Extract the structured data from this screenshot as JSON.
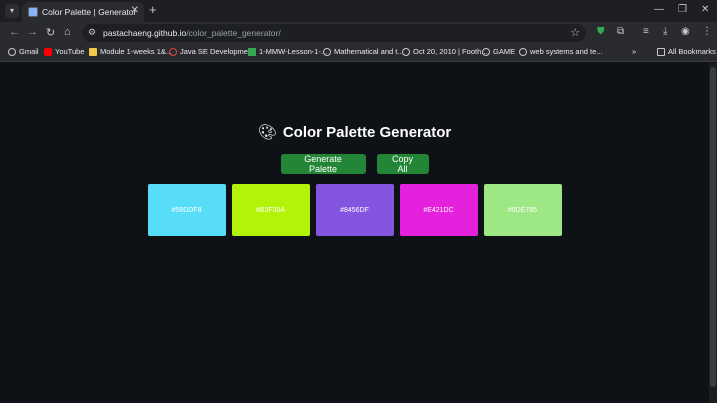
{
  "browser": {
    "tab_title": "Color Palette | Generator",
    "url_host": "pastachaeng.github.io",
    "url_path": "/color_palette_generator/",
    "bookmarks": [
      {
        "label": "Gmail",
        "color": "#c8c8c8"
      },
      {
        "label": "YouTube",
        "color": "#ff0000"
      },
      {
        "label": "Module 1-weeks 1&...",
        "color": "#f2c94c"
      },
      {
        "label": "Java SE Developme...",
        "color": "#e0443e"
      },
      {
        "label": "1-MMW-Lesson-1-...",
        "color": "#34a853"
      },
      {
        "label": "Mathematical and t...",
        "color": "#c8c8c8"
      },
      {
        "label": "Oct 20, 2010 | Footh...",
        "color": "#c8c8c8"
      },
      {
        "label": "GAME",
        "color": "#c8c8c8"
      },
      {
        "label": "web systems and te...",
        "color": "#c8c8c8"
      }
    ],
    "all_bookmarks": "All Bookmarks"
  },
  "page": {
    "title": "Color Palette Generator",
    "generate_label": "Generate Palette",
    "copy_label": "Copy All",
    "swatches": [
      {
        "hex": "#58DDF8",
        "color": "#58DDF8"
      },
      {
        "hex": "#B3F30A",
        "color": "#B3F30A"
      },
      {
        "hex": "#8456DF",
        "color": "#8456DF"
      },
      {
        "hex": "#E421DC",
        "color": "#E421DC"
      },
      {
        "hex": "#9DE785",
        "color": "#9DE785"
      }
    ]
  }
}
